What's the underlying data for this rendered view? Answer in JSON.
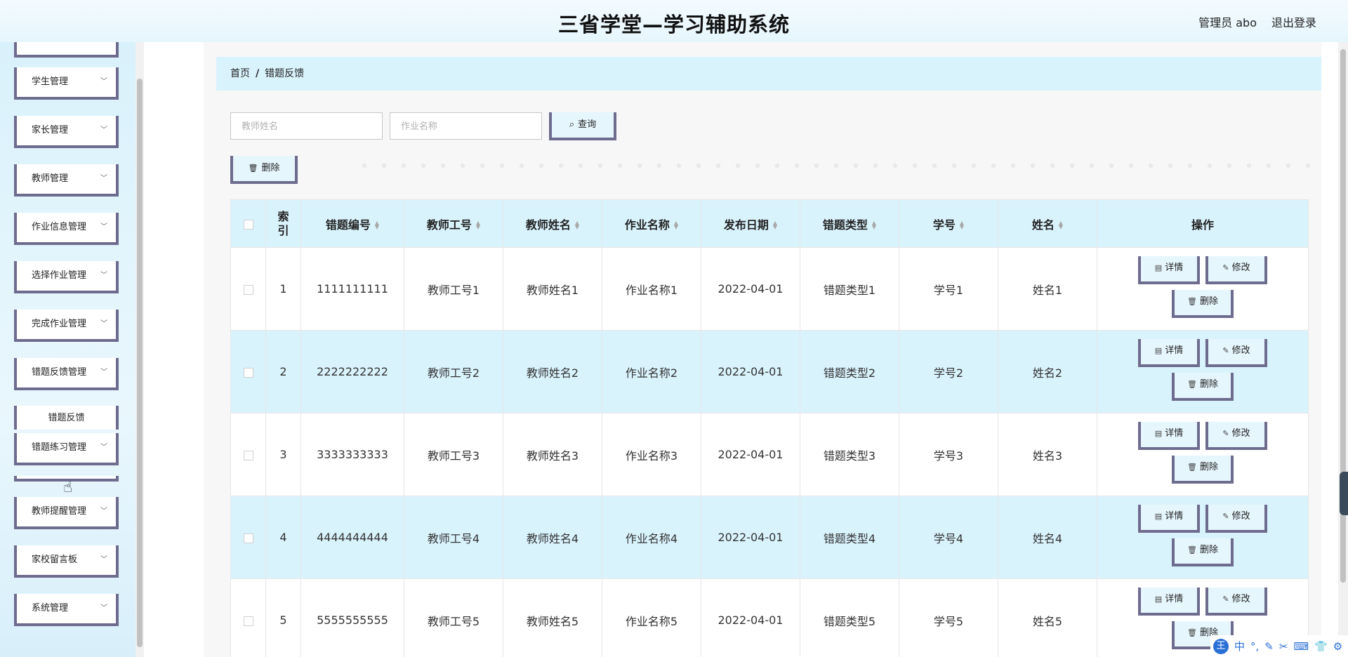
{
  "header": {
    "title": "三省学堂—学习辅助系统",
    "user": "管理员 abo",
    "logout": "退出登录"
  },
  "sidebar": {
    "items": [
      {
        "label": "学生管理"
      },
      {
        "label": "家长管理"
      },
      {
        "label": "教师管理"
      },
      {
        "label": "作业信息管理"
      },
      {
        "label": "选择作业管理"
      },
      {
        "label": "完成作业管理"
      },
      {
        "label": "错题反馈管理"
      },
      {
        "label": "错题练习管理"
      },
      {
        "label": "教师提醒管理"
      },
      {
        "label": "家校留言板"
      },
      {
        "label": "系统管理"
      }
    ],
    "sub_item": "错题反馈"
  },
  "breadcrumb": {
    "home": "首页",
    "separator": "/",
    "current": "错题反馈"
  },
  "search": {
    "teacher_name_placeholder": "教师姓名",
    "homework_name_placeholder": "作业名称",
    "search_label": "查询"
  },
  "toolbar": {
    "delete_label": "删除"
  },
  "table": {
    "columns": [
      "索引",
      "错题编号",
      "教师工号",
      "教师姓名",
      "作业名称",
      "发布日期",
      "错题类型",
      "学号",
      "姓名",
      "操作"
    ],
    "rows": [
      {
        "index": "1",
        "code": "1111111111",
        "teacher_id": "教师工号1",
        "teacher_name": "教师姓名1",
        "homework": "作业名称1",
        "date": "2022-04-01",
        "type": "错题类型1",
        "student_no": "学号1",
        "name": "姓名1"
      },
      {
        "index": "2",
        "code": "2222222222",
        "teacher_id": "教师工号2",
        "teacher_name": "教师姓名2",
        "homework": "作业名称2",
        "date": "2022-04-01",
        "type": "错题类型2",
        "student_no": "学号2",
        "name": "姓名2"
      },
      {
        "index": "3",
        "code": "3333333333",
        "teacher_id": "教师工号3",
        "teacher_name": "教师姓名3",
        "homework": "作业名称3",
        "date": "2022-04-01",
        "type": "错题类型3",
        "student_no": "学号3",
        "name": "姓名3"
      },
      {
        "index": "4",
        "code": "4444444444",
        "teacher_id": "教师工号4",
        "teacher_name": "教师姓名4",
        "homework": "作业名称4",
        "date": "2022-04-01",
        "type": "错题类型4",
        "student_no": "学号4",
        "name": "姓名4"
      },
      {
        "index": "5",
        "code": "5555555555",
        "teacher_id": "教师工号5",
        "teacher_name": "教师姓名5",
        "homework": "作业名称5",
        "date": "2022-04-01",
        "type": "错题类型5",
        "student_no": "学号5",
        "name": "姓名5"
      }
    ],
    "actions": {
      "detail": "详情",
      "edit": "修改",
      "delete": "删除"
    }
  },
  "ime": {
    "logo": "王",
    "mode": "中"
  },
  "colors": {
    "accent_light": "#d9f3fd",
    "button_border": "#6e6c8e"
  }
}
